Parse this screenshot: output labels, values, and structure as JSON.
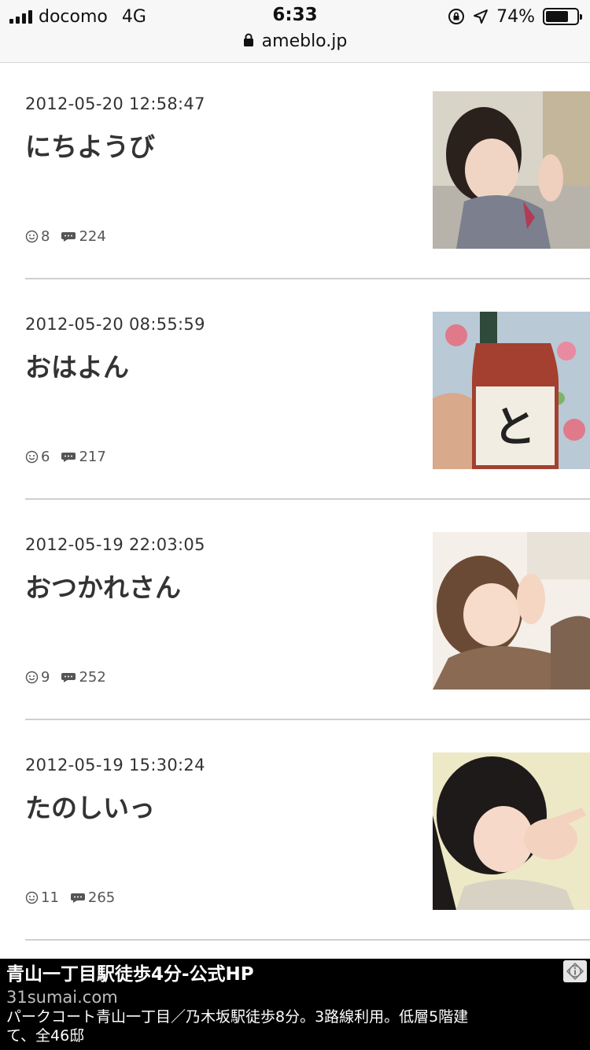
{
  "status_bar": {
    "carrier": "docomo",
    "network": "4G",
    "time": "6:33",
    "battery_percent": "74%",
    "battery_level": 0.74,
    "url": "ameblo.jp"
  },
  "posts": [
    {
      "date": "2012-05-20 12:58:47",
      "title": "にちようび",
      "likes": "8",
      "comments": "224"
    },
    {
      "date": "2012-05-20 08:55:59",
      "title": "おはよん",
      "likes": "6",
      "comments": "217"
    },
    {
      "date": "2012-05-19 22:03:05",
      "title": "おつかれさん",
      "likes": "9",
      "comments": "252"
    },
    {
      "date": "2012-05-19 15:30:24",
      "title": "たのしいっ",
      "likes": "11",
      "comments": "265"
    }
  ],
  "ad": {
    "title": "青山一丁目駅徒歩4分-公式HP",
    "domain": "31sumai.com",
    "description": "パークコート青山一丁目／乃木坂駅徒歩8分。3路線利用。低層5階建て、全46邸"
  },
  "icons": {
    "like": "smiley-icon",
    "comment": "speech-bubble-icon",
    "lock": "lock-icon",
    "ad_info": "info-icon"
  }
}
